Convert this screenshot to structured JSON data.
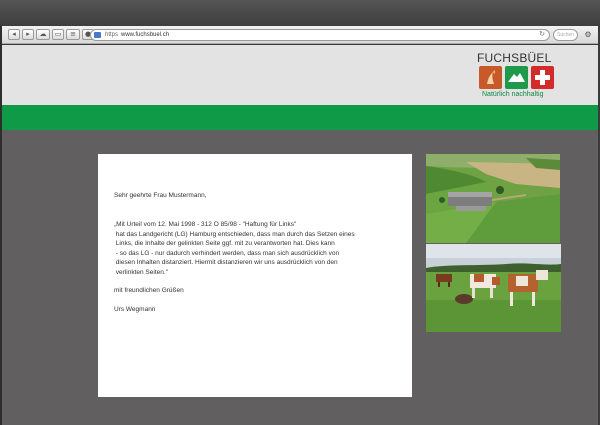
{
  "browser": {
    "url_scheme": "https",
    "url": "www.fuchsbuel.ch",
    "search_placeholder": "Suchen"
  },
  "brand": {
    "name": "FUCHSBÜEL",
    "tagline": "Natürlich nachhaltig",
    "colors": {
      "green": "#0e9a47",
      "orange": "#c85a2a",
      "red": "#d32a2a"
    }
  },
  "letter": {
    "salutation": "Sehr geehrte Frau Mustermann,",
    "quote_lines": [
      "„Mit Urteil vom 12. Mai 1998 - 312 O 85/98 - \"Haftung für Links\"",
      " hat das Landgericht (LG) Hamburg entschieden, dass man durch das Setzen eines",
      " Links, die Inhalte der gelinkten Seite ggf. mit zu verantworten hat. Dies kann",
      " - so das LG - nur dadurch verhindert werden, dass man sich ausdrücklich von",
      " diesen Inhalten distanziert. Hiermit distanzieren wir uns ausdrücklich von den",
      " verlinkten Seiten.\""
    ],
    "closing": "mit freundlichen Grüßen",
    "signature": "Urs Wegmann"
  },
  "photos": [
    {
      "name": "farm-aerial-photo",
      "subject": "aerial view of farm buildings and green fields"
    },
    {
      "name": "cows-pasture-photo",
      "subject": "red and white cows grazing on a pasture"
    }
  ]
}
